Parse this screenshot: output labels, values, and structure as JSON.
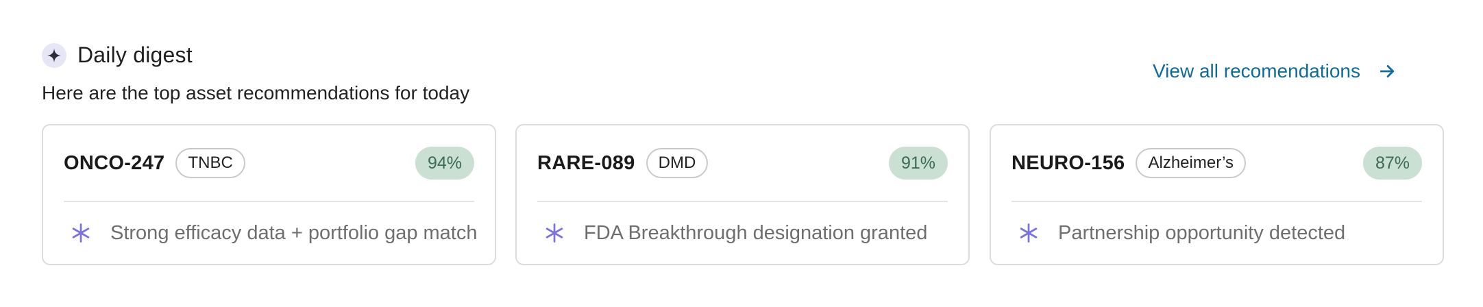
{
  "header": {
    "title": "Daily digest",
    "subtitle": "Here are the top asset recommendations for today",
    "view_all_label": "View all recomendations"
  },
  "icons": {
    "title_icon": "sparkle-icon",
    "link_icon": "arrow-right-icon",
    "reason_icon": "asterisk-icon"
  },
  "colors": {
    "accent_link": "#0f6b9a",
    "score_bg": "#c9e0d2",
    "score_text": "#3d6b53",
    "reason_icon": "#7b72e0"
  },
  "cards": [
    {
      "asset_id": "ONCO-247",
      "tag": "TNBC",
      "score": "94%",
      "reason": "Strong efficacy data + portfolio gap match"
    },
    {
      "asset_id": "RARE-089",
      "tag": "DMD",
      "score": "91%",
      "reason": "FDA Breakthrough designation granted"
    },
    {
      "asset_id": "NEURO-156",
      "tag": "Alzheimer’s",
      "score": "87%",
      "reason": "Partnership opportunity detected"
    }
  ]
}
